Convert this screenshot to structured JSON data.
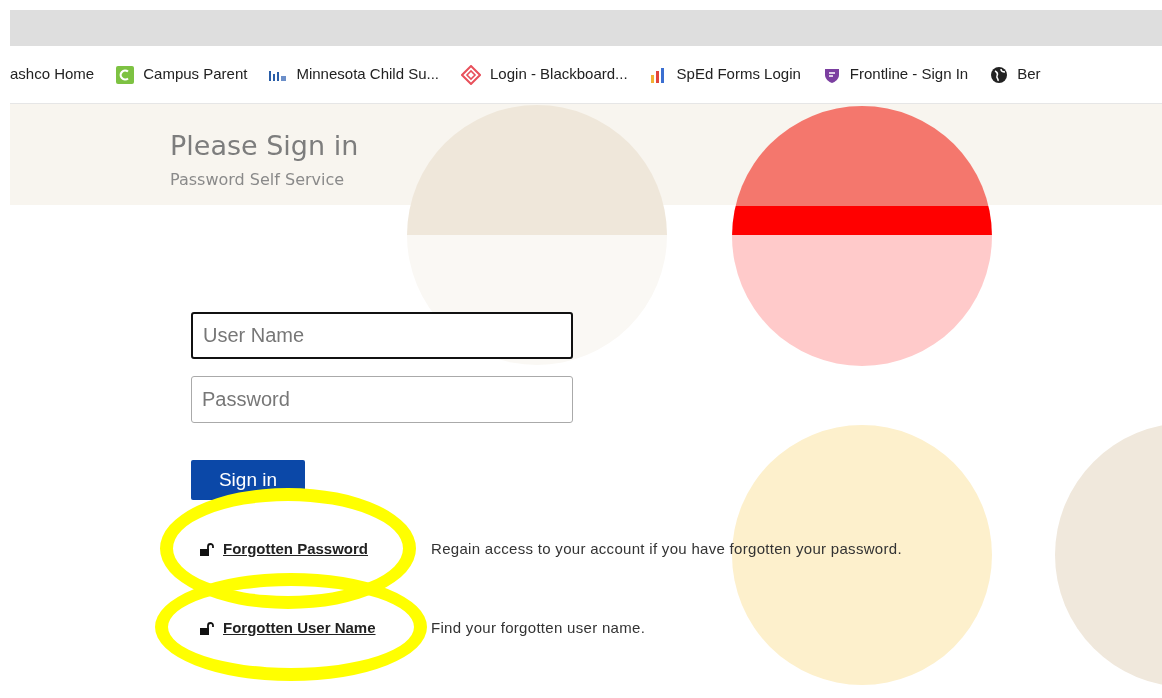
{
  "bookmarks_bar": {
    "items": [
      {
        "kind": "generic",
        "label": "ashco Home"
      },
      {
        "kind": "campus",
        "label": "Campus Parent"
      },
      {
        "kind": "chart",
        "label": "Minnesota Child Su..."
      },
      {
        "kind": "diamond",
        "label": "Login - Blackboard..."
      },
      {
        "kind": "bars",
        "label": "SpEd Forms Login"
      },
      {
        "kind": "shield",
        "label": "Frontline - Sign In"
      },
      {
        "kind": "globe",
        "label": "Ber"
      }
    ]
  },
  "header": {
    "title": "Please Sign in",
    "subtitle": "Password Self Service"
  },
  "form": {
    "fields": [
      {
        "placeholder": "User Name",
        "focused": true
      },
      {
        "placeholder": "Password",
        "focused": false
      }
    ],
    "submit": "Sign in"
  },
  "help_links": [
    {
      "link": "Forgotten Password",
      "description": "Regain access to your account if you have forgotten your password.",
      "circled": true
    },
    {
      "link": "Forgotten User Name",
      "description": "Find your forgotten user name.",
      "circled": true
    }
  ]
}
